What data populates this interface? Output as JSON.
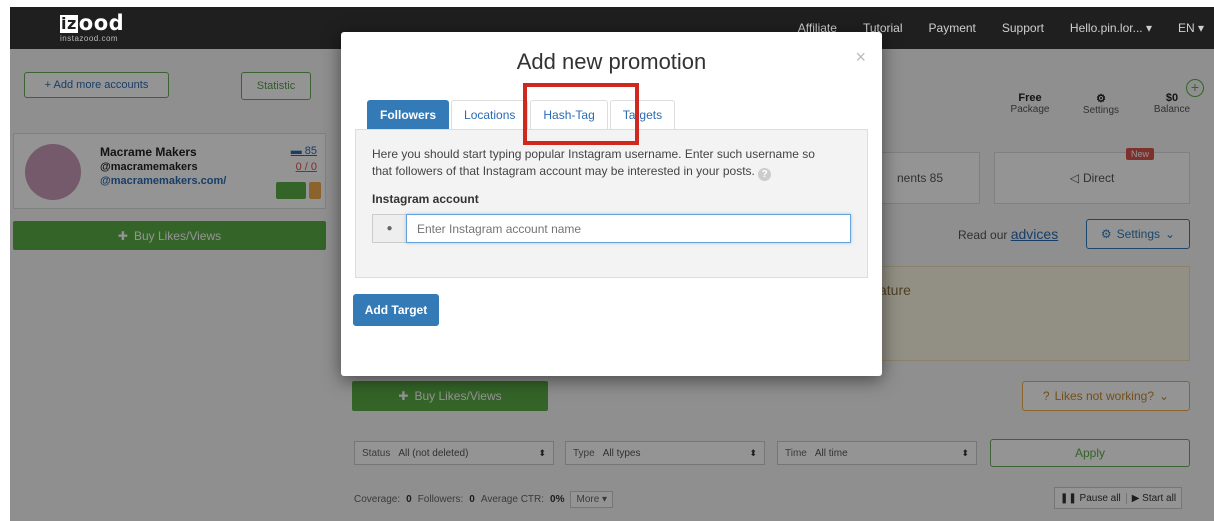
{
  "topbar": {
    "logo_mark": "iz",
    "logo_text": "ood",
    "logo_sub": "instazood.com",
    "nav": [
      "Affiliate",
      "Tutorial",
      "Payment",
      "Support",
      "Hello.pin.lor... ▾",
      "EN ▾"
    ]
  },
  "sidebar": {
    "add_accounts": "+ Add more accounts",
    "statistic": "Statistic",
    "account": {
      "name": "Macrame Makers",
      "handle": "@macramemakers",
      "link": "@macramemakers.com/",
      "count": "85",
      "ratio": "0 / 0"
    },
    "buy_button": "Buy Likes/Views"
  },
  "stats": [
    {
      "value": "Free",
      "label": "Package"
    },
    {
      "value": "⚙",
      "label": "Settings"
    },
    {
      "value": "$0",
      "label": "Balance"
    }
  ],
  "main": {
    "comments_tab": "nents 85",
    "direct_tab": "Direct",
    "new_badge": "New",
    "read_our": "Read our",
    "advices": "advices",
    "settings_btn": "Settings",
    "feature_text": "ature",
    "buy_button": "Buy Likes/Views",
    "likes_not_working": "Likes not working?",
    "filters": [
      {
        "label": "Status",
        "value": "All (not deleted)"
      },
      {
        "label": "Type",
        "value": "All types"
      },
      {
        "label": "Time",
        "value": "All time"
      }
    ],
    "apply": "Apply",
    "footer": {
      "coverage_label": "Coverage:",
      "coverage": "0",
      "followers_label": "Followers:",
      "followers": "0",
      "ctr_label": "Average CTR:",
      "ctr": "0%",
      "more": "More ▾",
      "pause_all": "Pause all",
      "start_all": "Start all"
    }
  },
  "modal": {
    "title": "Add new promotion",
    "close": "×",
    "tabs": [
      "Followers",
      "Locations",
      "Hash-Tag",
      "Targets"
    ],
    "description": "Here you should start typing popular Instagram username. Enter such username so that followers of that Instagram account may be interested in your posts.",
    "field_label": "Instagram account",
    "input_placeholder": "Enter Instagram account name",
    "submit": "Add Target"
  }
}
